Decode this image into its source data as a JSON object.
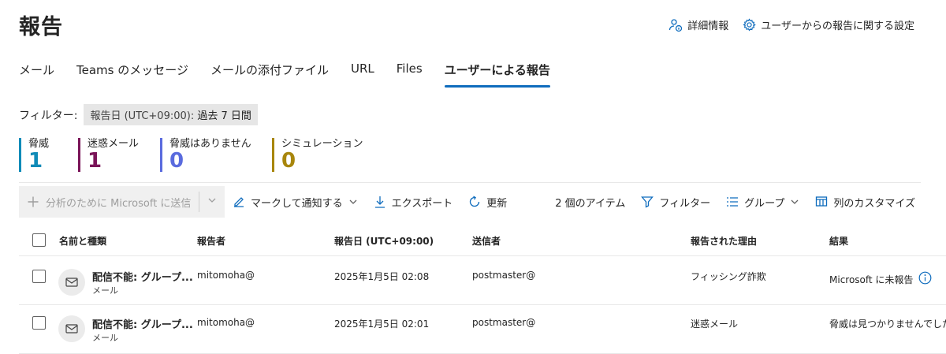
{
  "page": {
    "title": "報告",
    "details_label": "詳細情報",
    "settings_label": "ユーザーからの報告に関する設定"
  },
  "tabs": [
    {
      "label": "メール"
    },
    {
      "label": "Teams のメッセージ"
    },
    {
      "label": "メールの添付ファイル"
    },
    {
      "label": "URL"
    },
    {
      "label": "Files"
    },
    {
      "label": "ユーザーによる報告"
    }
  ],
  "filter": {
    "label": "フィルター:",
    "chip_key": "報告日 (UTC+09:00):",
    "chip_value": " 過去 7 日間"
  },
  "stats": [
    {
      "label": "脅威",
      "value": "1",
      "color": "#0f8bb8"
    },
    {
      "label": "迷惑メール",
      "value": "1",
      "color": "#7a1458"
    },
    {
      "label": "脅威はありません",
      "value": "0",
      "color": "#5a6bde"
    },
    {
      "label": "シミュレーション",
      "value": "0",
      "color": "#a8860c"
    }
  ],
  "toolbar": {
    "submit_label": "分析のために Microsoft に送信",
    "mark_label": "マークして通知する",
    "export_label": "エクスポート",
    "refresh_label": "更新",
    "item_count": "2 個のアイテム",
    "filter_label": "フィルター",
    "group_label": "グループ",
    "customize_label": "列のカスタマイズ"
  },
  "table": {
    "headers": {
      "name": "名前と種類",
      "reporter": "報告者",
      "date": "報告日 (UTC+09:00)",
      "sender": "送信者",
      "reason": "報告された理由",
      "result": "結果"
    },
    "rows": [
      {
        "name": "配信不能: グループ...",
        "type": "メール",
        "reporter": "mitomoha@",
        "date": "2025年1月5日 02:08",
        "sender": "postmaster@",
        "reason": "フィッシング詐欺",
        "result": "Microsoft に未報告"
      },
      {
        "name": "配信不能: グループ...",
        "type": "メール",
        "reporter": "mitomoha@",
        "date": "2025年1月5日 02:01",
        "sender": "postmaster@",
        "reason": "迷惑メール",
        "result": "脅威は見つかりませんでした"
      }
    ]
  },
  "colors": {
    "accent": "#0f6cbd"
  }
}
